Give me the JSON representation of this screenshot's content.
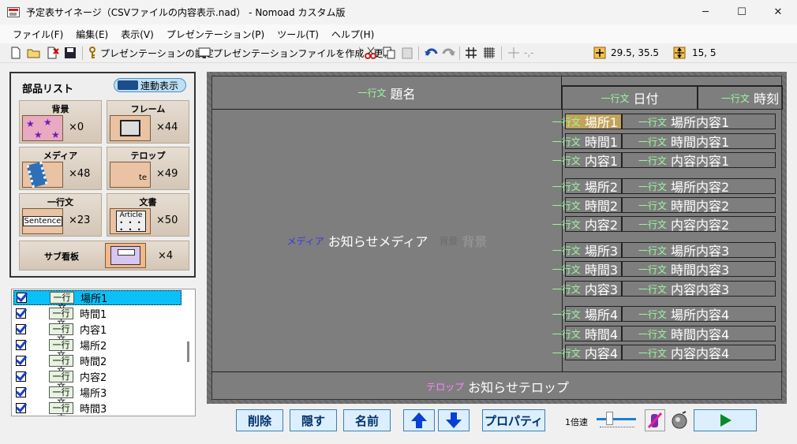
{
  "window": {
    "title": "予定表サイネージ（CSVファイルの内容表示.nad） - Nomoad カスタム版",
    "minimize": "─",
    "maximize": "☐",
    "close": "✕"
  },
  "menu": [
    "ファイル(F)",
    "編集(E)",
    "表示(V)",
    "プレゼンテーション(P)",
    "ツール(T)",
    "ヘルプ(H)"
  ],
  "toolbar": {
    "settings_label": "プレゼンテーションの設定",
    "create_label": "プレゼンテーションファイルを作成・更新",
    "pos_text": "-,-",
    "coord1": "29.5, 35.5",
    "coord2": "15, 5"
  },
  "parts": {
    "title": "部品リスト",
    "link_label": "連動表示",
    "tiles": [
      {
        "label": "背景",
        "count": "×0"
      },
      {
        "label": "フレーム",
        "count": "×44"
      },
      {
        "label": "メディア",
        "count": "×48"
      },
      {
        "label": "テロップ",
        "count": "×49"
      },
      {
        "label": "一行文",
        "count": "×23",
        "thumb": "Sentence"
      },
      {
        "label": "文書",
        "count": "×50",
        "thumb": "Article"
      },
      {
        "label": "サブ看板",
        "count": "×4"
      }
    ],
    "telop_thumb": "te"
  },
  "layers": [
    {
      "tag": "一行文",
      "name": "場所1"
    },
    {
      "tag": "一行文",
      "name": "時間1"
    },
    {
      "tag": "一行文",
      "name": "内容1"
    },
    {
      "tag": "一行文",
      "name": "場所2"
    },
    {
      "tag": "一行文",
      "name": "時間2"
    },
    {
      "tag": "一行文",
      "name": "内容2"
    },
    {
      "tag": "一行文",
      "name": "場所3"
    },
    {
      "tag": "一行文",
      "name": "時間3"
    }
  ],
  "stage": {
    "line_tag": "一行文",
    "media_tag": "メディア",
    "bg_tag": "背景",
    "telop_tag": "テロップ",
    "title_text": "題名",
    "date_text": "日付",
    "time_text": "時刻",
    "media_text": "お知らせメディア",
    "bg_text": "背景",
    "telop_text": "お知らせテロップ",
    "rows": [
      {
        "left": "場所1",
        "right": "場所内容1"
      },
      {
        "left": "時間1",
        "right": "時間内容1"
      },
      {
        "left": "内容1",
        "right": "内容内容1"
      },
      {
        "left": "場所2",
        "right": "場所内容2"
      },
      {
        "left": "時間2",
        "right": "時間内容2"
      },
      {
        "left": "内容2",
        "right": "内容内容2"
      },
      {
        "left": "場所3",
        "right": "場所内容3"
      },
      {
        "left": "時間3",
        "right": "時間内容3"
      },
      {
        "left": "内容3",
        "right": "内容内容3"
      },
      {
        "left": "場所4",
        "right": "場所内容4"
      },
      {
        "left": "時間4",
        "right": "時間内容4"
      },
      {
        "left": "内容4",
        "right": "内容内容4"
      }
    ]
  },
  "bottom": {
    "delete": "削除",
    "hide": "隠す",
    "name": "名前",
    "properties": "プロパティ",
    "speed": "1倍速",
    "accent": "#2a86d8"
  }
}
